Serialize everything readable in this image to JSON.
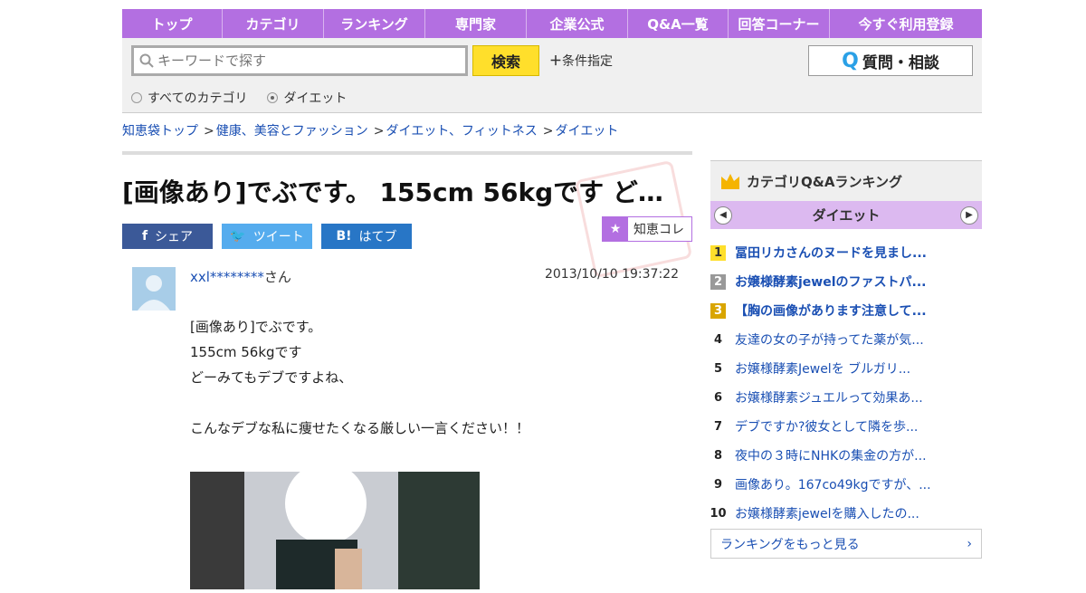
{
  "nav": [
    "トップ",
    "カテゴリ",
    "ランキング",
    "専門家",
    "企業公式",
    "Q&A一覧",
    "回答コーナー",
    "今すぐ利用登録"
  ],
  "search": {
    "placeholder": "キーワードで探す",
    "button": "検索",
    "condition": "条件指定"
  },
  "ask_button": "質問・相談",
  "radios": [
    {
      "label": "すべてのカテゴリ",
      "checked": false
    },
    {
      "label": "ダイエット",
      "checked": true
    }
  ],
  "breadcrumb": [
    "知恵袋トップ",
    "健康、美容とファッション",
    "ダイエット、フィットネス",
    "ダイエット"
  ],
  "question": {
    "title": "[画像あり]でぶです。 155cm 56kgです どーみ…",
    "share": {
      "facebook": "シェア",
      "twitter": "ツイート",
      "hatena": "はてブ"
    },
    "chiekore": "知恵コレ",
    "user": "xxl********",
    "user_suffix": "さん",
    "date": "2013/10/10  19:37:22",
    "lines": [
      "[画像あり]でぶです。",
      "155cm 56kgです",
      "どーみてもデブですよね、",
      "",
      "こんなデブな私に痩せたくなる厳しい一言ください！！"
    ]
  },
  "ranking": {
    "title": "カテゴリQ&Aランキング",
    "category": "ダイエット",
    "items": [
      {
        "rank": "1",
        "text": "冨田リカさんのヌードを見まし..."
      },
      {
        "rank": "2",
        "text": "お嬢様酵素jewelのファストパ..."
      },
      {
        "rank": "3",
        "text": "【胸の画像があります注意して..."
      },
      {
        "rank": "4",
        "text": "友達の女の子が持ってた薬が気..."
      },
      {
        "rank": "5",
        "text": "お嬢様酵素Jewelを ブルガリ..."
      },
      {
        "rank": "6",
        "text": "お嬢様酵素ジュエルって効果あ..."
      },
      {
        "rank": "7",
        "text": "デブですか?彼女として隣を歩..."
      },
      {
        "rank": "8",
        "text": "夜中の３時にNHKの集金の方が..."
      },
      {
        "rank": "9",
        "text": "画像あり。167co49kgですが、..."
      },
      {
        "rank": "10",
        "text": "お嬢様酵素jewelを購入したの..."
      }
    ],
    "more": "ランキングをもっと見る"
  }
}
